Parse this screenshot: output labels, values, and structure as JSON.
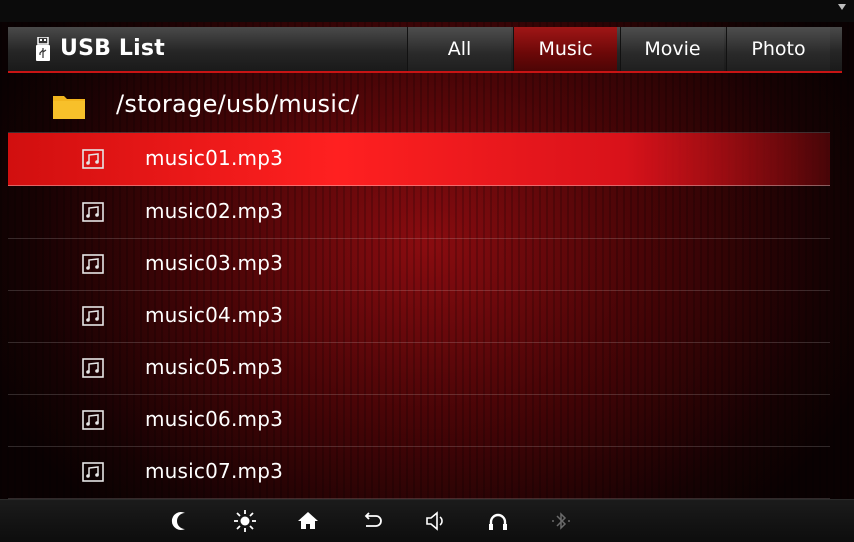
{
  "header": {
    "title": "USB List",
    "tabs": [
      {
        "label": "All",
        "active": false
      },
      {
        "label": "Music",
        "active": true
      },
      {
        "label": "Movie",
        "active": false
      },
      {
        "label": "Photo",
        "active": false
      }
    ]
  },
  "path": "/storage/usb/music/",
  "files": [
    {
      "name": "music01.mp3",
      "selected": true
    },
    {
      "name": "music02.mp3",
      "selected": false
    },
    {
      "name": "music03.mp3",
      "selected": false
    },
    {
      "name": "music04.mp3",
      "selected": false
    },
    {
      "name": "music05.mp3",
      "selected": false
    },
    {
      "name": "music06.mp3",
      "selected": false
    },
    {
      "name": "music07.mp3",
      "selected": false
    }
  ],
  "bottom_bar": {
    "icons": [
      "moon-icon",
      "brightness-icon",
      "home-icon",
      "back-icon",
      "volume-icon",
      "call-icon",
      "bluetooth-icon"
    ]
  },
  "colors": {
    "accent": "#ff2020",
    "active_tab": "#8a0f0f",
    "folder": "#f2b51e"
  }
}
